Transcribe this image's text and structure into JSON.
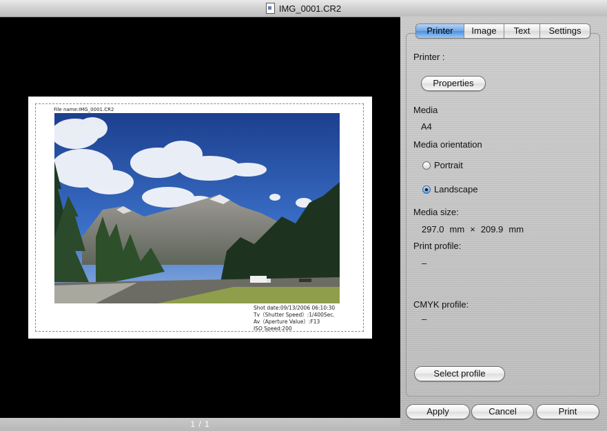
{
  "window": {
    "title": "IMG_0001.CR2"
  },
  "preview": {
    "file_name": "File name:IMG_0001.CR2",
    "shot_info": [
      "Shot date:09/13/2006 06:10:30",
      "Tv（Shutter Speed）:1/400Sec.",
      "Av（Aperture Value）:F13",
      "ISO Speed:200"
    ],
    "page_indicator": "1 / 1"
  },
  "tabs": [
    {
      "label": "Printer",
      "active": true
    },
    {
      "label": "Image",
      "active": false
    },
    {
      "label": "Text",
      "active": false
    },
    {
      "label": "Settings",
      "active": false
    }
  ],
  "printer_panel": {
    "printer_label": "Printer :",
    "properties_button": "Properties",
    "media_label": "Media",
    "media_value": "A4",
    "orientation_label": "Media orientation",
    "orientation_options": [
      {
        "label": "Portrait",
        "selected": false
      },
      {
        "label": "Landscape",
        "selected": true
      }
    ],
    "media_size_label": "Media size:",
    "media_size_width": "297.0",
    "media_size_height": "209.9",
    "media_size_unit": "mm",
    "media_size_sep": "×",
    "print_profile_label": "Print profile:",
    "print_profile_value": "–",
    "cmyk_profile_label": "CMYK profile:",
    "cmyk_profile_value": "–",
    "select_profile_button": "Select profile"
  },
  "footer": {
    "apply_button": "Apply",
    "cancel_button": "Cancel",
    "print_button": "Print"
  },
  "colors": {
    "tab_active": "#6ea5e6",
    "preview_background": "#000000"
  }
}
